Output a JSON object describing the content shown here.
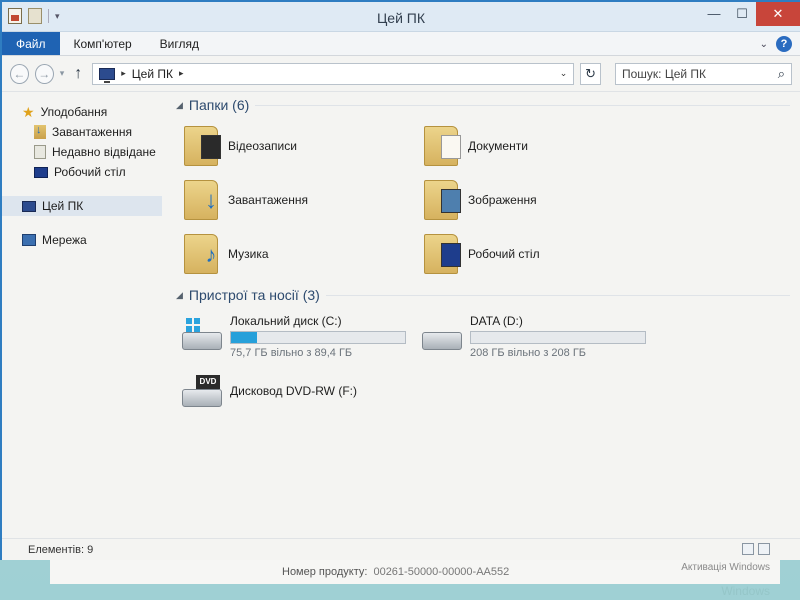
{
  "window": {
    "title": "Цей ПК"
  },
  "ribbon": {
    "tabs": [
      "Файл",
      "Комп'ютер",
      "Вигляд"
    ]
  },
  "address": {
    "crumb": "Цей ПК"
  },
  "search": {
    "placeholder": "Пошук: Цей ПК"
  },
  "nav": {
    "favorites": "Уподобання",
    "favorites_items": [
      "Завантаження",
      "Недавно відвідане",
      "Робочий стіл"
    ],
    "this_pc": "Цей ПК",
    "network": "Мережа"
  },
  "folders": {
    "header": "Папки (6)",
    "items": [
      {
        "label": "Відеозаписи",
        "icon": "video-folder-icon"
      },
      {
        "label": "Документи",
        "icon": "documents-folder-icon"
      },
      {
        "label": "Завантаження",
        "icon": "downloads-folder-icon"
      },
      {
        "label": "Зображення",
        "icon": "pictures-folder-icon"
      },
      {
        "label": "Музика",
        "icon": "music-folder-icon"
      },
      {
        "label": "Робочий стіл",
        "icon": "desktop-folder-icon"
      }
    ]
  },
  "devices": {
    "header": "Пристрої та носії (3)",
    "items": [
      {
        "name": "Локальний диск (C:)",
        "free": "75,7 ГБ вільно з 89,4 ГБ",
        "used_fraction": 0.15
      },
      {
        "name": "DATA (D:)",
        "free": "208 ГБ вільно з 208 ГБ",
        "used_fraction": 0.0
      },
      {
        "name": "Дисковод DVD-RW (F:)",
        "badge": "DVD"
      }
    ]
  },
  "status": {
    "items": "Елементів: 9"
  },
  "desktop": {
    "product_label": "Номер продукту:",
    "product_value": "00261-50000-00000-AA552",
    "activation": "Активація Windows",
    "watermark": "Windows"
  },
  "colors": {
    "accent": "#1f63b3",
    "progress": "#26a0da",
    "close": "#c8453a"
  }
}
